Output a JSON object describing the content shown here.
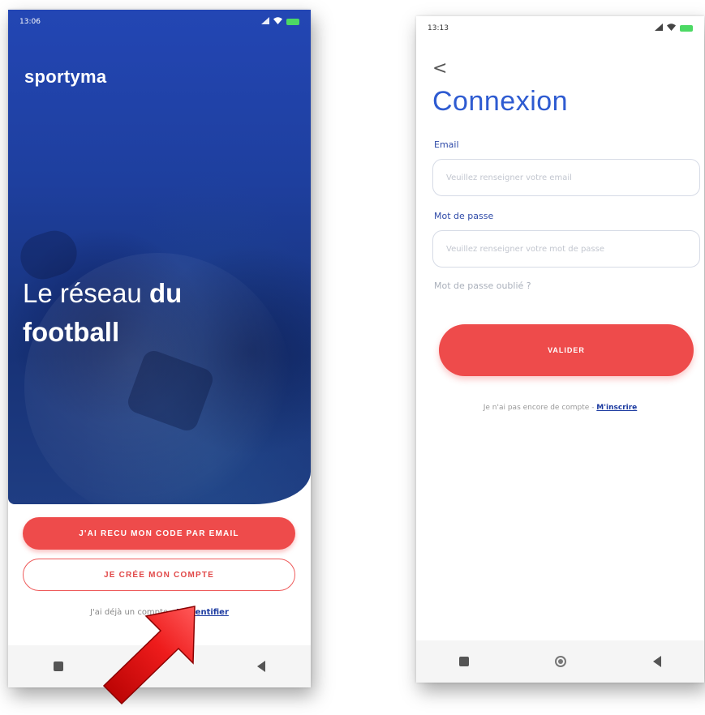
{
  "left_screen": {
    "status_time": "13:06",
    "brand": "sportyma",
    "tagline_light": "Le réseau ",
    "tagline_bold_1": "du",
    "tagline_bold_2": "football",
    "primary_button": "J'AI RECU MON CODE PAR EMAIL",
    "secondary_button": "JE CRÉE MON COMPTE",
    "login_prompt": "J'ai déjà un compte - ",
    "login_link": "M'identifier"
  },
  "right_screen": {
    "status_time": "13:13",
    "back_label": "<",
    "title": "Connexion",
    "email_label": "Email",
    "email_placeholder": "Veuillez renseigner votre email",
    "password_label": "Mot de passe",
    "password_placeholder": "Veuillez renseigner votre mot de passe",
    "forgot_password": "Mot de passe oublié ?",
    "submit_button": "VALIDER",
    "signup_prompt": "Je n'ai pas encore de compte - ",
    "signup_link": "M'inscrire"
  },
  "colors": {
    "brand_blue": "#2346b4",
    "accent_red": "#ee4b4b",
    "title_blue": "#2e5bd1",
    "link_blue": "#1b3aa0"
  },
  "icons": {
    "status": [
      "signal-icon",
      "wifi-icon",
      "battery-icon"
    ],
    "nav": [
      "recent-apps-icon",
      "home-icon",
      "back-icon"
    ],
    "annotation": "red-arrow-icon"
  }
}
